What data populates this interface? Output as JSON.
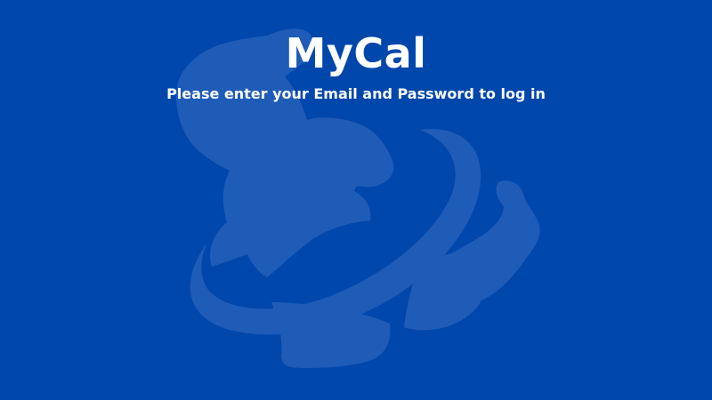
{
  "app": {
    "title": "MyCal",
    "instruction": "Please enter your Email and Password to log in"
  },
  "background": {
    "color": "#0047ab",
    "logo_icon": "flexing-bodybuilder-logo-icon",
    "logo_color": "#1f5fb8"
  }
}
